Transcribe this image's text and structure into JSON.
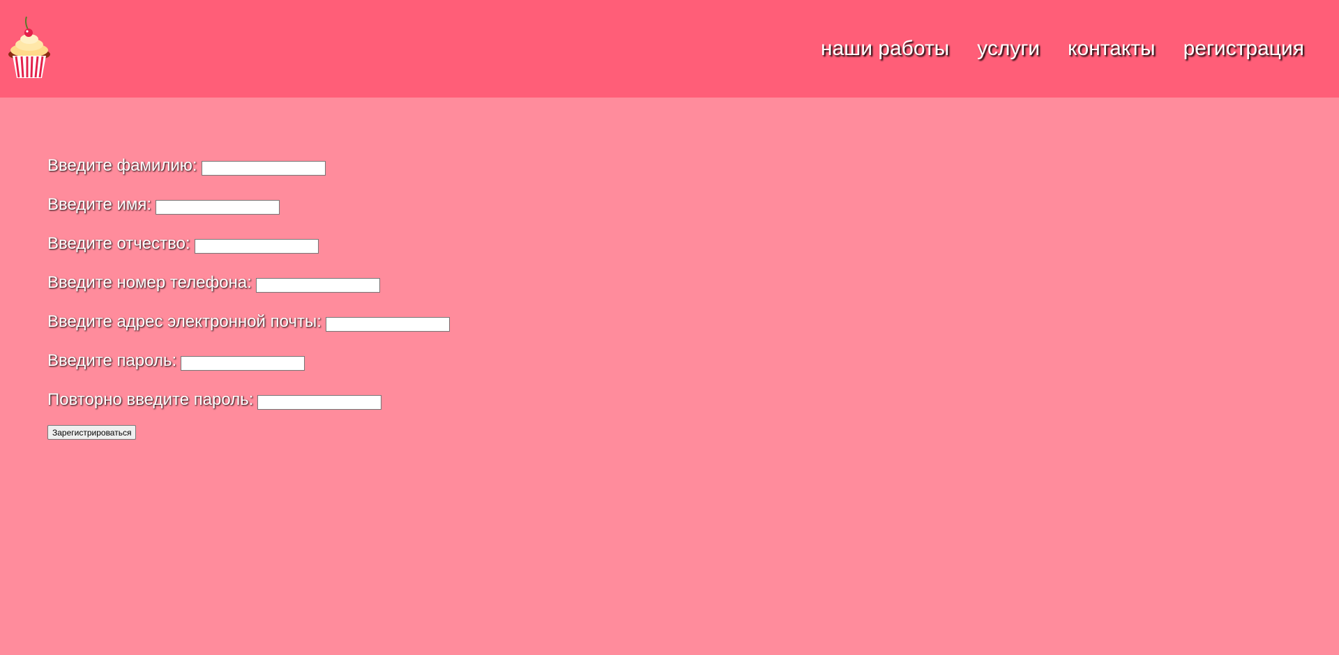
{
  "header": {
    "logo_icon": "cupcake-icon",
    "nav": [
      {
        "label": "наши работы"
      },
      {
        "label": "услуги"
      },
      {
        "label": "контакты"
      },
      {
        "label": "регистрация"
      }
    ]
  },
  "form": {
    "fields": [
      {
        "label": "Введите фамилию:",
        "value": ""
      },
      {
        "label": "Введите имя:",
        "value": ""
      },
      {
        "label": "Введите отчество:",
        "value": ""
      },
      {
        "label": "Введите номер телефона:",
        "value": ""
      },
      {
        "label": "Введите адрес электронной почты:",
        "value": ""
      },
      {
        "label": "Введите пароль:",
        "value": ""
      },
      {
        "label": "Повторно введите пароль:",
        "value": ""
      }
    ],
    "submit_label": "Зарегистрироваться"
  },
  "colors": {
    "header_bg": "#ff5e78",
    "page_bg": "#ff8c9c",
    "text": "#ffffff"
  }
}
